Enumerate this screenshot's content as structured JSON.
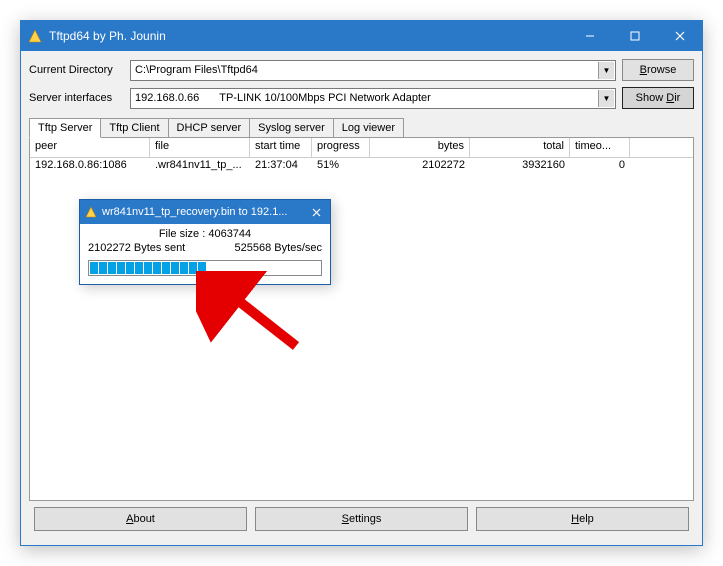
{
  "window": {
    "title": "Tftpd64 by Ph. Jounin"
  },
  "fields": {
    "curdir_label": "Current Directory",
    "curdir_value": "C:\\Program Files\\Tftpd64",
    "browse_label": "Browse",
    "srvint_label": "Server interfaces",
    "srvint_ip": "192.168.0.66",
    "srvint_desc": "TP-LINK 10/100Mbps PCI Network Adapter",
    "showdir_label": "Show Dir"
  },
  "tabs": {
    "server": "Tftp Server",
    "client": "Tftp Client",
    "dhcp": "DHCP server",
    "syslog": "Syslog server",
    "log": "Log viewer"
  },
  "columns": {
    "peer": "peer",
    "file": "file",
    "start": "start time",
    "progress": "progress",
    "bytes": "bytes",
    "total": "total",
    "timeouts": "timeo..."
  },
  "row": {
    "peer": "192.168.0.86:1086",
    "file": ".wr841nv11_tp_...",
    "start": "21:37:04",
    "progress": "51%",
    "bytes": "2102272",
    "total": "3932160",
    "timeouts": "0"
  },
  "dialog": {
    "title": "wr841nv11_tp_recovery.bin to 192.1...",
    "filesize_label": "File size : 4063744",
    "sent": "2102272 Bytes sent",
    "rate": "525568 Bytes/sec",
    "progress_segments": 13,
    "filled_segments": 13
  },
  "buttons": {
    "about": "About",
    "settings": "Settings",
    "help": "Help"
  },
  "colors": {
    "accent": "#2a78c8",
    "progress": "#06a2e7"
  }
}
